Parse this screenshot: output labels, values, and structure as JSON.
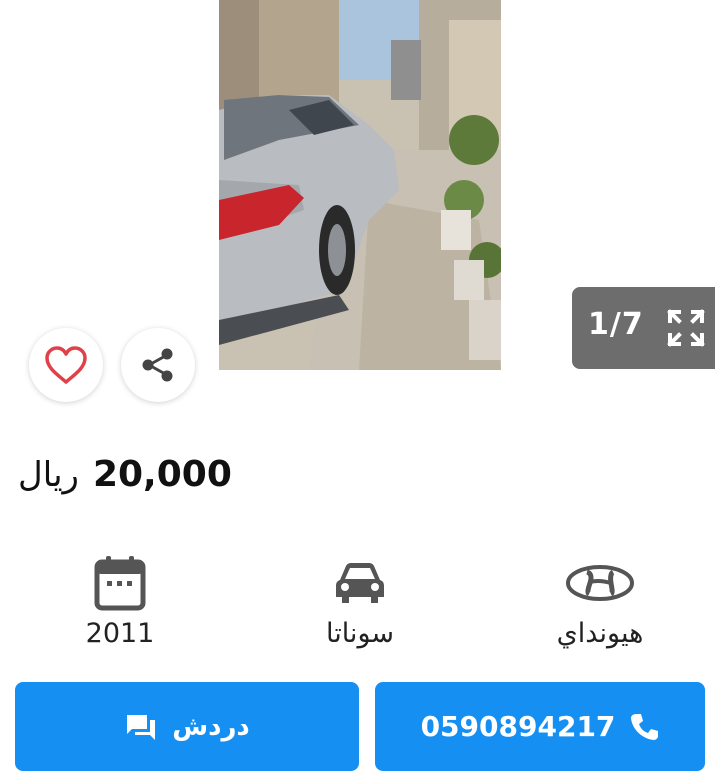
{
  "gallery": {
    "counter": "1/7",
    "prev_icon": "chevron-left-icon",
    "next_icon": "chevron-right-icon",
    "fullscreen_icon": "fullscreen-icon"
  },
  "actions": {
    "favorite_icon": "heart-icon",
    "share_icon": "share-icon"
  },
  "price": {
    "value": "20,000",
    "currency": "ريال"
  },
  "specs": {
    "year": "2011",
    "model": "سوناتا",
    "make": "هيونداي"
  },
  "buttons": {
    "chat_label": "دردش",
    "chat_icon": "chat-icon",
    "call_number": "0590894217",
    "call_icon": "phone-icon"
  },
  "colors": {
    "accent": "#1590f2",
    "heart": "#e0404a",
    "counter_bg": "#6d6d6d"
  }
}
